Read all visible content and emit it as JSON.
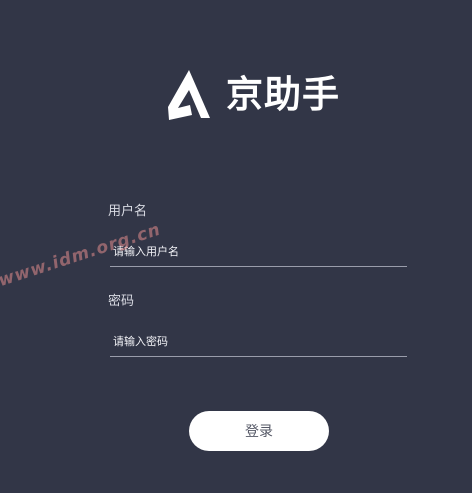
{
  "brand": {
    "name": "京助手",
    "logo_icon": "stylized-a-logo-icon"
  },
  "form": {
    "username": {
      "label": "用户名",
      "placeholder": "请输入用户名",
      "value": ""
    },
    "password": {
      "label": "密码",
      "placeholder": "请输入密码",
      "value": ""
    },
    "submit_label": "登录"
  },
  "watermark": {
    "text": "www.idm.org.cn"
  },
  "colors": {
    "background": "#323647",
    "button_background": "#ffffff",
    "text_primary": "#ffffff"
  }
}
